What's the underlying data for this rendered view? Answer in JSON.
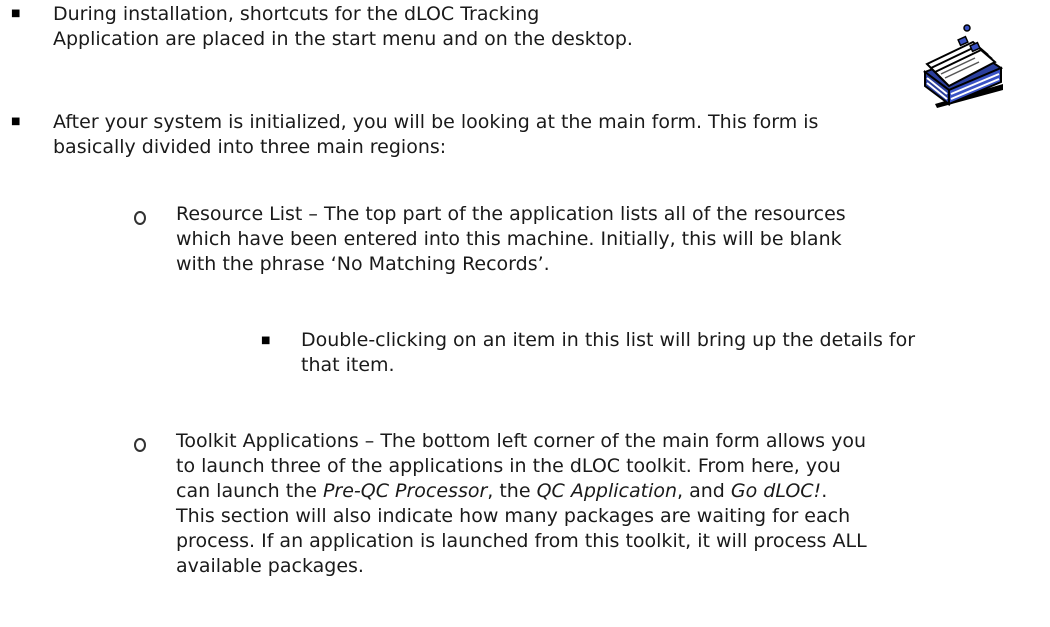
{
  "doc": {
    "bullet1": {
      "line1": "During installation, shortcuts for the dLOC Tracking",
      "line2": "Application are placed in the start menu and on the desktop."
    },
    "bullet2": {
      "line1": "After your system is initialized, you will be looking at the main form.   This form is",
      "line2": "basically divided into three main regions:"
    },
    "resource_list": {
      "line1": "Resource List – The top part of the application lists all of the resources",
      "line2": "which have been entered into this machine.  Initially, this will be blank",
      "line3": "with the phrase ‘No Matching Records’."
    },
    "double_click": {
      "line1": "Double-clicking on an item in this list will bring up the details for",
      "line2": "that item."
    },
    "toolkit": {
      "line1": "Toolkit Applications – The bottom left corner of the main form allows you",
      "line2": "to launch three of the applications in the dLOC toolkit.  From here, you",
      "line3_pre": "can launch the ",
      "app1": "Pre-QC Processor",
      "line3_mid1": ", the ",
      "app2": "QC Application",
      "line3_mid2": ", and ",
      "app3": "Go dLOC!",
      "line3_post": ".",
      "line4": "This section will also indicate how many packages are waiting for each",
      "line5": "process.  If an application is launched from this toolkit, it will process ALL",
      "line6": "available packages."
    },
    "icon": "card-file-icon"
  }
}
